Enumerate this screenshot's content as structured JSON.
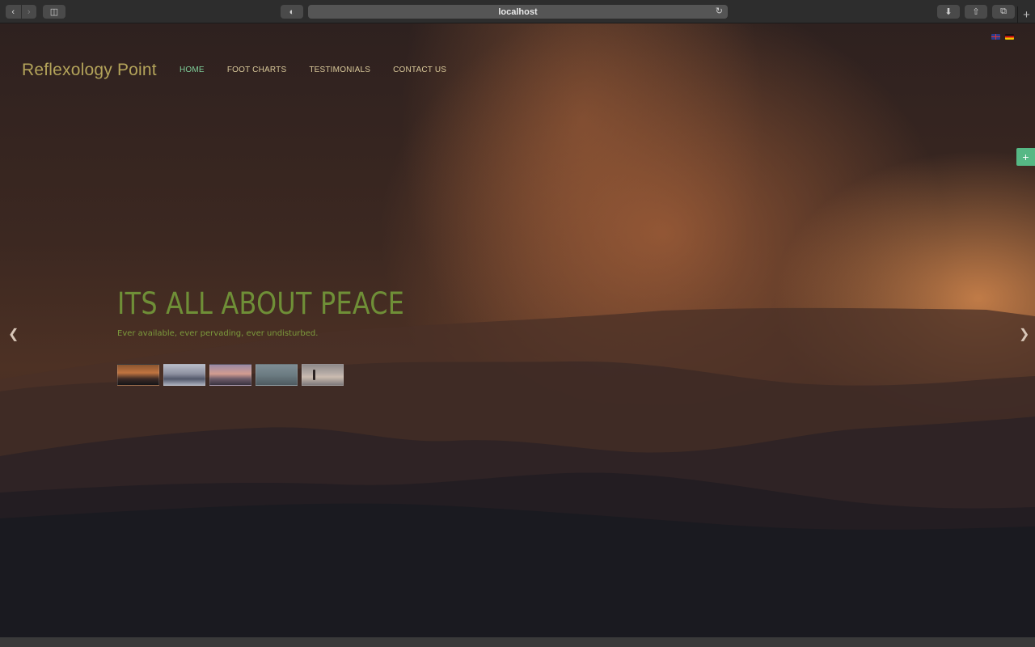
{
  "browser": {
    "url": "localhost",
    "back_icon": "chevron-left-icon",
    "forward_icon": "chevron-right-icon",
    "sidebar_icon": "sidebar-icon",
    "reload_icon": "reload-icon",
    "download_icon": "download-icon",
    "share_icon": "share-icon",
    "tabs_icon": "tabs-icon",
    "new_tab_icon": "plus-icon"
  },
  "site": {
    "logo": "Reflexology Point",
    "nav": [
      {
        "label": "HOME",
        "active": true
      },
      {
        "label": "FOOT CHARTS",
        "active": false
      },
      {
        "label": "TESTIMONIALS",
        "active": false
      },
      {
        "label": "CONTACT US",
        "active": false
      }
    ],
    "languages": [
      "English",
      "German"
    ]
  },
  "hero": {
    "title": "ITS ALL ABOUT PEACE",
    "subtitle": "Ever available, ever pervading, ever undisturbed.",
    "thumbnail_count": 5
  },
  "colors": {
    "logo": "#b3a35a",
    "nav_active": "#7fcf9a",
    "hero_title": "#6f8f37",
    "accent_button": "#56b885"
  }
}
